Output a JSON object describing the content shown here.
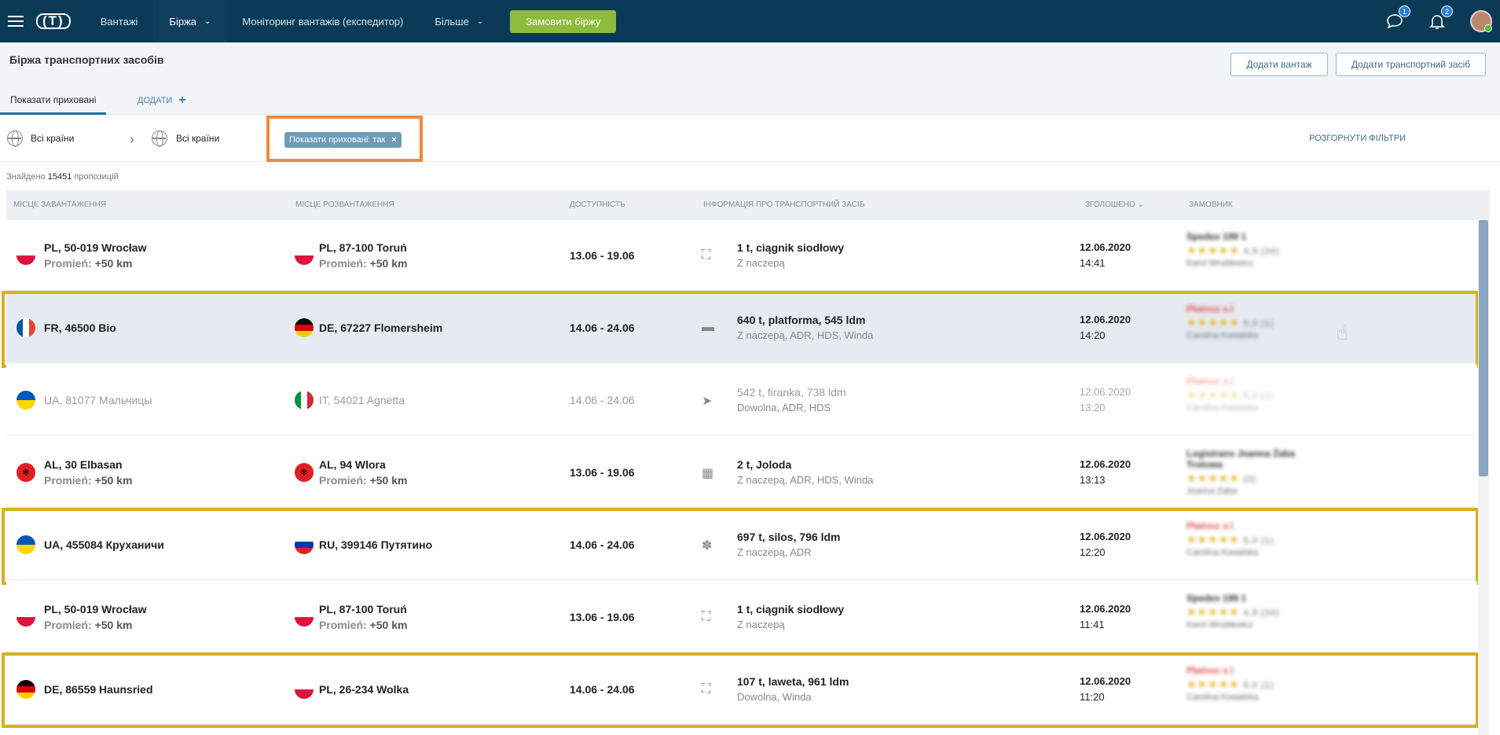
{
  "topbar": {
    "logo": "(T)",
    "nav": [
      {
        "label": "Вантажі"
      },
      {
        "label": "Біржа"
      },
      {
        "label": "Моніторинг вантажів (експедитор)"
      },
      {
        "label": "Більше"
      }
    ],
    "order_button": "Замовити біржу",
    "messages_badge": "1",
    "notifications_badge": "2"
  },
  "header": {
    "title": "Біржа транспортних засобів",
    "add_cargo": "Додати вантаж",
    "add_vehicle": "Додати транспортний засіб",
    "tab_active": "Показати приховані",
    "tab_add": "ДОДАТИ"
  },
  "filters": {
    "from": "Всі країни",
    "to": "Всі країни",
    "chip": "Показати приховані: так",
    "expand": "РОЗГОРНУТИ ФІЛЬТРИ"
  },
  "found": {
    "prefix": "Знайдено",
    "count": "15451",
    "suffix": "пропозицій"
  },
  "columns": {
    "loading": "МІСЦЕ ЗАВАНТАЖЕННЯ",
    "unloading": "МІСЦЕ РОЗВАНТАЖЕННЯ",
    "availability": "ДОСТУПНІСТЬ",
    "vehicle": "ІНФОРМАЦІЯ ПРО ТРАНСПОРТНИЙ ЗАСІБ",
    "announced": "ЗГОЛОШЕНО",
    "customer": "ЗАМОВНИК"
  },
  "rows": [
    {
      "from_flag": "pl",
      "from": "PL, 50-019 Wrocław",
      "from_radius_label": "Promień:",
      "from_radius": "+50 km",
      "to_flag": "pl",
      "to": "PL, 87-100 Toruń",
      "to_radius_label": "Promień:",
      "to_radius": "+50 km",
      "avail": "13.06 - 19.06",
      "vehicle_icon": "truck-icon",
      "vehicle": "1 t, ciągnik siodłowy",
      "vehicle_sub": "Z naczepą",
      "date": "12.06.2020",
      "time": "14:41",
      "customer": "Spedex 199 1",
      "rating": "4,8 (34)",
      "person": "Karol Wrublewicz",
      "state": "normal",
      "framed": false
    },
    {
      "from_flag": "fr",
      "from": "FR, 46500 Bio",
      "to_flag": "de",
      "to": "DE, 67227 Flomersheim",
      "avail": "14.06 - 24.06",
      "vehicle_icon": "flatbed-icon",
      "vehicle": "640 t, platforma, 545 ldm",
      "vehicle_sub": "Z naczepą, ADR, HDS, Winda",
      "date": "12.06.2020",
      "time": "14:20",
      "customer": "Płatnoz s.l",
      "rating": "5,0 (1)",
      "person": "Carolina Kowalska",
      "state": "highlight",
      "framed": true
    },
    {
      "from_flag": "ua",
      "from": "UA, 81077 Мальчицы",
      "to_flag": "it",
      "to": "IT, 54021 Agnetta",
      "avail": "14.06 - 24.06",
      "vehicle_icon": "curtain-icon",
      "vehicle": "542 t, firanka, 738 ldm",
      "vehicle_sub": "Dowolna, ADR, HDS",
      "date": "12.06.2020",
      "time": "13:20",
      "customer": "Płatnoz s.l",
      "rating": "5,0 (1)",
      "person": "Carolina Kowalska",
      "state": "dim",
      "framed": false
    },
    {
      "from_flag": "al",
      "from": "AL, 30 Elbasan",
      "from_radius_label": "Promień:",
      "from_radius": "+50 km",
      "to_flag": "al",
      "to": "AL, 94 Wlora",
      "to_radius_label": "Promień:",
      "to_radius": "+50 km",
      "avail": "13.06 - 19.06",
      "vehicle_icon": "container-icon",
      "vehicle": "2 t, Joloda",
      "vehicle_sub": "Z naczepą, ADR, HDS, Winda",
      "date": "12.06.2020",
      "time": "13:13",
      "customer": "Logistrans Joanna Żaba Trotowa",
      "rating": "(0)",
      "person": "Joanna Żaba",
      "state": "normal",
      "framed": false
    },
    {
      "from_flag": "ua",
      "from": "UA, 455084 Круханичи",
      "to_flag": "ru",
      "to": "RU, 399146 Путятино",
      "avail": "14.06 - 24.06",
      "vehicle_icon": "grain-icon",
      "vehicle": "697 t, silos, 796 ldm",
      "vehicle_sub": "Z naczepą, ADR",
      "date": "12.06.2020",
      "time": "12:20",
      "customer": "Płatnoz s.l",
      "rating": "5,0 (1)",
      "person": "Carolina Kowalska",
      "state": "normal",
      "framed": true
    },
    {
      "from_flag": "pl",
      "from": "PL, 50-019 Wrocław",
      "from_radius_label": "Promień:",
      "from_radius": "+50 km",
      "to_flag": "pl",
      "to": "PL, 87-100 Toruń",
      "to_radius_label": "Promień:",
      "to_radius": "+50 km",
      "avail": "13.06 - 19.06",
      "vehicle_icon": "truck-icon",
      "vehicle": "1 t, ciągnik siodłowy",
      "vehicle_sub": "Z naczepą",
      "date": "12.06.2020",
      "time": "11:41",
      "customer": "Spedex 199 1",
      "rating": "4,8 (34)",
      "person": "Karol Wrublewicz",
      "state": "normal",
      "framed": false
    },
    {
      "from_flag": "de",
      "from": "DE, 86559 Haunsried",
      "to_flag": "pl",
      "to": "PL, 26-234 Wolka",
      "avail": "14.06 - 24.06",
      "vehicle_icon": "tow-truck-icon",
      "vehicle": "107 t, laweta, 961 ldm",
      "vehicle_sub": "Dowolna, Winda",
      "date": "12.06.2020",
      "time": "11:20",
      "customer": "Płatnoz s.l",
      "rating": "5,0 (1)",
      "person": "Carolina Kowalska",
      "state": "normal",
      "framed": true
    }
  ],
  "colors": {
    "topbar": "#0b3a56",
    "accent_green": "#8dbb3b",
    "frame_orange": "#f08a3c",
    "frame_yellow": "#d6b11e",
    "link": "#3d6a88"
  }
}
